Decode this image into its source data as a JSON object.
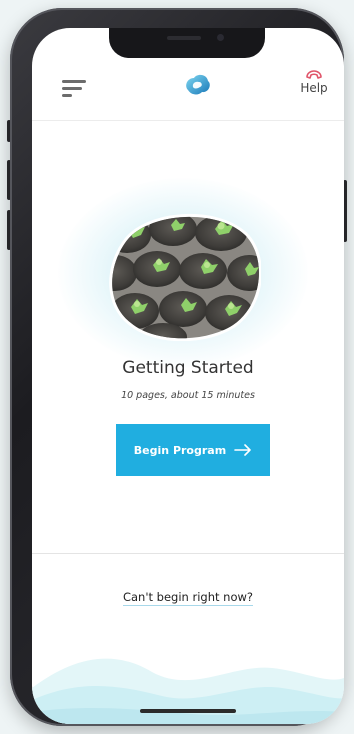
{
  "header": {
    "menu_icon": "hamburger-menu-icon",
    "logo_icon": "cloud-logo-icon",
    "help": {
      "icon": "phone-handset-icon",
      "label": "Help"
    }
  },
  "program": {
    "title": "Getting Started",
    "subtitle": "10 pages, about 15 minutes",
    "image": "plant-seedlings-photo",
    "begin_button": {
      "label": "Begin Program",
      "icon": "arrow-right-icon"
    }
  },
  "footer": {
    "cant_begin_link": "Can't begin right now?"
  },
  "colors": {
    "accent": "#20aee0",
    "help_icon": "#e0556a",
    "glow": "#8cd4e8",
    "waves": "#cdeff4"
  }
}
